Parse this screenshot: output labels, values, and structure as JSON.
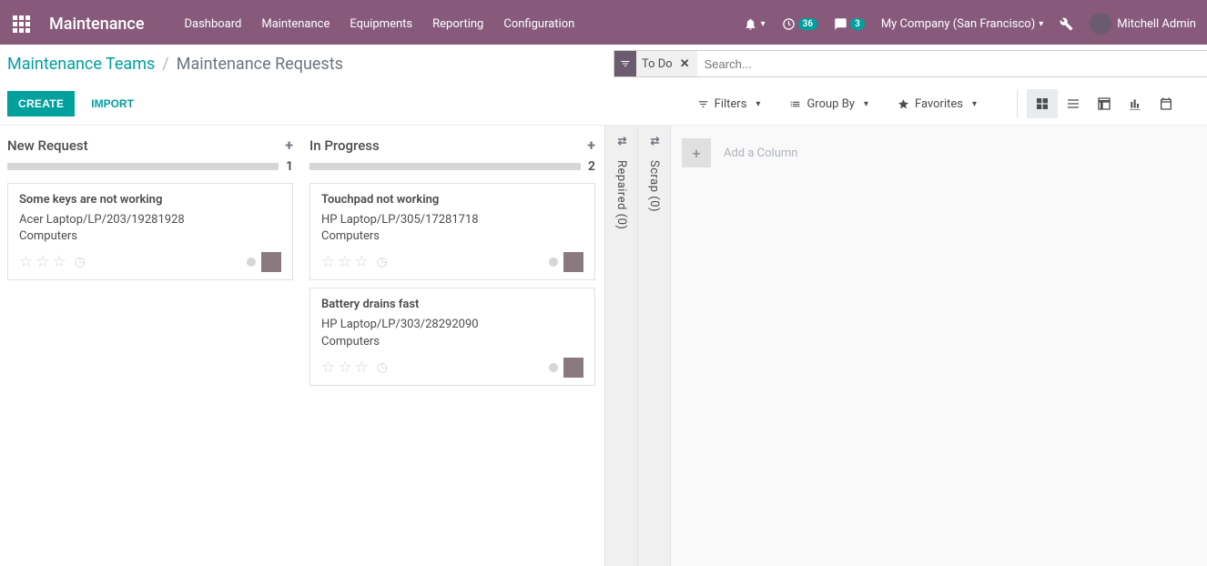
{
  "header": {
    "brand": "Maintenance",
    "menu": [
      "Dashboard",
      "Maintenance",
      "Equipments",
      "Reporting",
      "Configuration"
    ],
    "clock_badge": "36",
    "chat_badge": "3",
    "company": "My Company (San Francisco)",
    "user": "Mitchell Admin"
  },
  "breadcrumb": {
    "parent": "Maintenance Teams",
    "current": "Maintenance Requests"
  },
  "search": {
    "facet_label": "To Do",
    "placeholder": "Search..."
  },
  "buttons": {
    "create": "CREATE",
    "import": "IMPORT"
  },
  "filters": {
    "filters": "Filters",
    "group_by": "Group By",
    "favorites": "Favorites"
  },
  "columns": [
    {
      "title": "New Request",
      "count": "1",
      "cards": [
        {
          "title": "Some keys are not working",
          "line1": "Acer Laptop/LP/203/19281928",
          "line2": "Computers"
        }
      ]
    },
    {
      "title": "In Progress",
      "count": "2",
      "cards": [
        {
          "title": "Touchpad not working",
          "line1": "HP Laptop/LP/305/17281718",
          "line2": "Computers"
        },
        {
          "title": "Battery drains fast",
          "line1": "HP Laptop/LP/303/28292090",
          "line2": "Computers"
        }
      ]
    }
  ],
  "folded": [
    {
      "label": "Repaired (0)"
    },
    {
      "label": "Scrap (0)"
    }
  ],
  "add_column": "Add a Column"
}
